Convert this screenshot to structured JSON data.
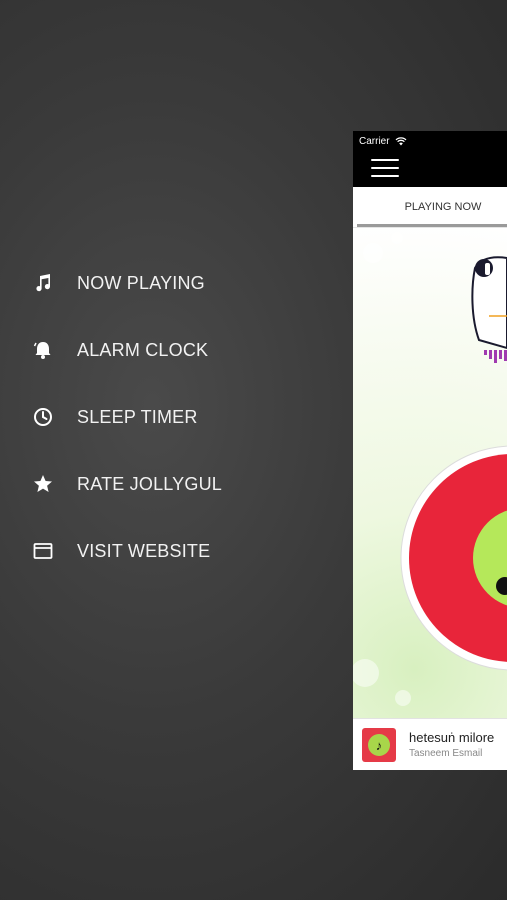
{
  "menu": {
    "items": [
      {
        "label": "NOW PLAYING",
        "icon": "music-note-icon"
      },
      {
        "label": "ALARM CLOCK",
        "icon": "bell-icon"
      },
      {
        "label": "SLEEP TIMER",
        "icon": "clock-icon"
      },
      {
        "label": "RATE JOLLYGUL",
        "icon": "star-icon"
      },
      {
        "label": "VISIT WEBSITE",
        "icon": "browser-window-icon"
      }
    ]
  },
  "status_bar": {
    "carrier": "Carrier"
  },
  "tabs": [
    {
      "label": "PLAYING NOW"
    }
  ],
  "player": {
    "track_title": "hetesuṅ milore",
    "artist": "Tasneem Esmail"
  },
  "colors": {
    "background": "#3a3a3a",
    "disc_red": "#e8253a",
    "disc_green": "#b5e85a",
    "thumb_red": "#e53a47"
  }
}
